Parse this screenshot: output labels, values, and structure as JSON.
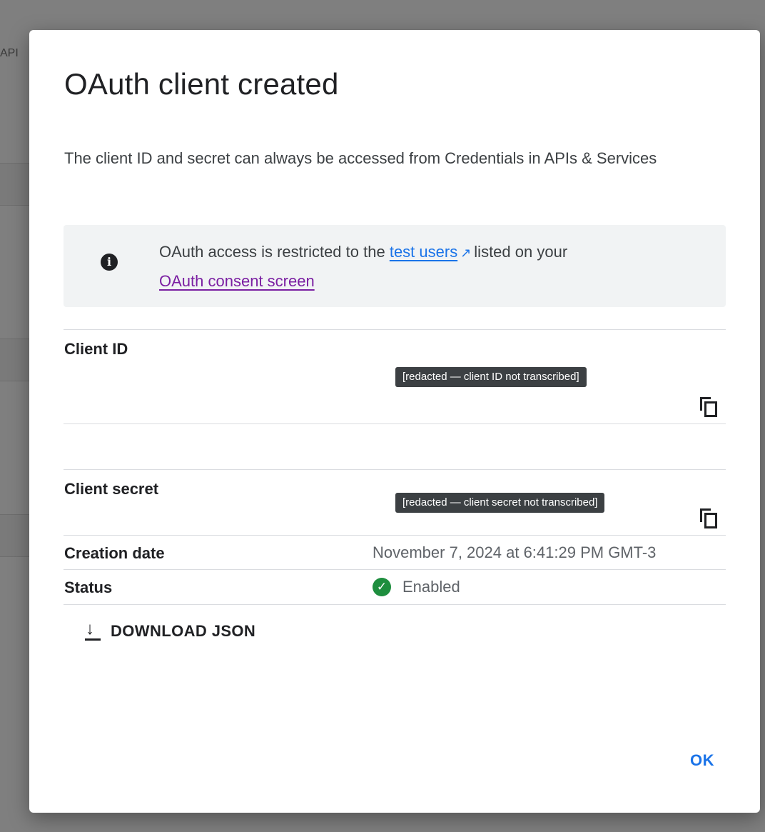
{
  "background": {
    "left_label": "API"
  },
  "dialog": {
    "title": "OAuth client created",
    "description": "The client ID and secret can always be accessed from Credentials in APIs & Services",
    "notice": {
      "text_before": "OAuth access is restricted to the",
      "link_test_users": "test users",
      "text_after": "listed on your",
      "link_consent": "OAuth consent screen"
    },
    "client_id": {
      "label": "Client ID",
      "value": "[redacted — client ID not transcribed]"
    },
    "client_secret": {
      "label": "Client secret",
      "value": "[redacted — client secret not transcribed]"
    },
    "creation_date": {
      "label": "Creation date",
      "value": "November 7, 2024 at 6:41:29 PM GMT-3"
    },
    "status": {
      "label": "Status",
      "value": "Enabled"
    },
    "download_label": "DOWNLOAD JSON",
    "ok_label": "OK"
  },
  "colors": {
    "accent": "#1a73e8",
    "visited_link": "#7b1fa2",
    "success": "#1e8e3e"
  },
  "icons": [
    "info-icon",
    "external-link-icon",
    "copy-icon",
    "check-circle-icon",
    "download-icon"
  ]
}
